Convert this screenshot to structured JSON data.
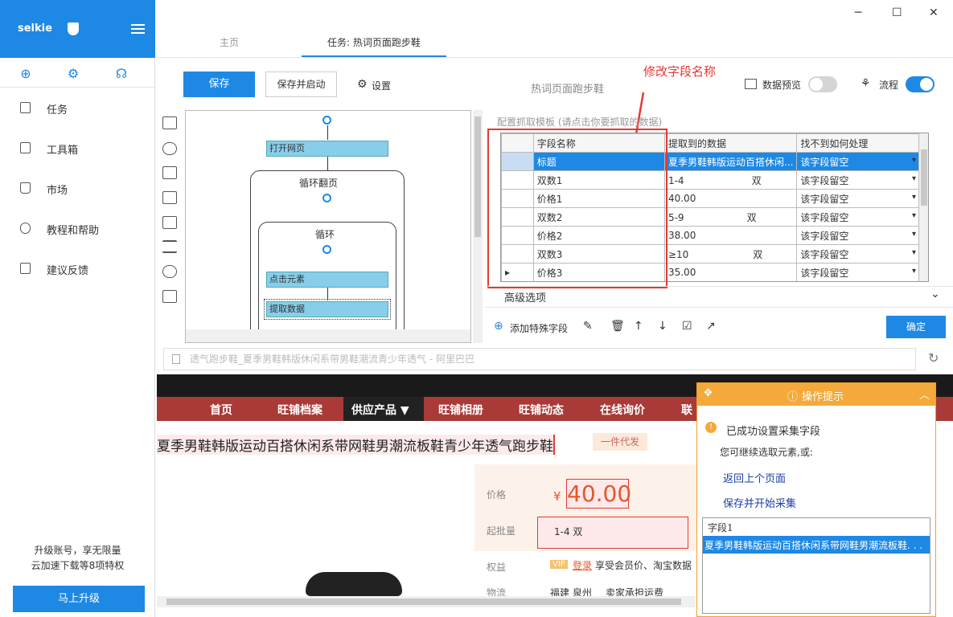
{
  "app": {
    "brand": "selkie"
  },
  "sidebar": {
    "items": [
      {
        "label": "任务",
        "icon": "document-icon"
      },
      {
        "label": "工具箱",
        "icon": "toolbox-icon"
      },
      {
        "label": "市场",
        "icon": "bag-icon"
      },
      {
        "label": "教程和帮助",
        "icon": "question-icon"
      },
      {
        "label": "建议反馈",
        "icon": "chat-icon"
      }
    ],
    "upgrade_line1": "升级账号，享无限量",
    "upgrade_line2": "云加速下载等8项特权",
    "upgrade_button": "马上升级"
  },
  "tabs": [
    {
      "label": "主页"
    },
    {
      "label": "任务: 热词页面跑步鞋"
    }
  ],
  "toolbar": {
    "save": "保存",
    "save_run": "保存并启动",
    "settings": "设置",
    "task_name": "热词页面跑步鞋",
    "preview": "数据预览",
    "flow": "流程"
  },
  "annotation": "修改字段名称",
  "flow": {
    "open_page": "打开网页",
    "loop_page": "循环翻页",
    "loop": "循环",
    "click": "点击元素",
    "extract": "提取数据"
  },
  "panel": {
    "hint": "配置抓取模板 (请点击你要抓取的数据)",
    "columns": [
      "字段名称",
      "提取到的数据",
      "找不到如何处理"
    ],
    "rows": [
      {
        "name": "标题",
        "value": "夏季男鞋韩版运动百搭休闲...",
        "action": "该字段留空"
      },
      {
        "name": "双数1",
        "value": "1-4",
        "extra": "双",
        "action": "该字段留空"
      },
      {
        "name": "价格1",
        "value": "40.00",
        "action": "该字段留空"
      },
      {
        "name": "双数2",
        "value": "5-9",
        "extra": "双",
        "action": "该字段留空"
      },
      {
        "name": "价格2",
        "value": "38.00",
        "action": "该字段留空"
      },
      {
        "name": "双数3",
        "value": "≥10",
        "extra": "双",
        "action": "该字段留空"
      },
      {
        "name": "价格3",
        "value": "35.00",
        "action": "该字段留空"
      }
    ],
    "advanced": "高级选项",
    "add_special": "添加特殊字段",
    "ok": "确定"
  },
  "url_bar": {
    "text": "透气跑步鞋_夏季男鞋韩版休闲系带男鞋潮流青少年透气 - 阿里巴巴"
  },
  "web": {
    "nav": [
      "首页",
      "旺铺档案",
      "供应产品 ▼",
      "旺铺相册",
      "旺铺动态",
      "在线询价",
      "联"
    ],
    "title": "夏季男鞋韩版运动百搭休闲系带网鞋男潮流板鞋青少年透气跑步鞋",
    "badge": "一件代发",
    "price_label": "价格",
    "price_symbol": "¥",
    "price": "40.00",
    "batch_label": "起批量",
    "batch_value": "1-4 双",
    "rights_label": "权益",
    "vip": "VIP",
    "login": "登录",
    "rights_text": "享受会员价、淘宝数据",
    "logistics_label": "物流",
    "logistics_from": "福建 泉州",
    "logistics_text": "卖家承担运费"
  },
  "popup": {
    "title": "操作提示",
    "success": "已成功设置采集字段",
    "sub": "您可继续选取元素,或:",
    "back": "返回上个页面",
    "save_start": "保存并开始采集",
    "field_label": "字段1",
    "field_value": "夏季男鞋韩版运动百搭休闲系带网鞋男潮流板鞋. . ."
  }
}
